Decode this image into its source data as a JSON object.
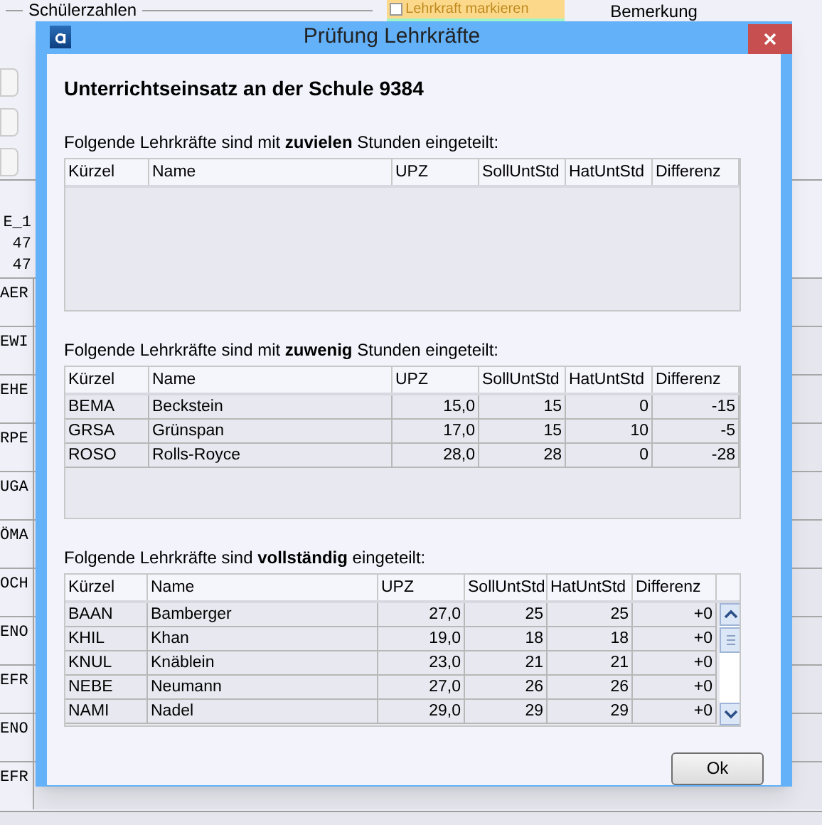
{
  "background": {
    "group_title": "Schülerzahlen",
    "highlight_button": "Lehrkraft markieren",
    "column_header": "Bemerkung",
    "grid_header": [
      "E_1",
      "47",
      "47"
    ],
    "row_labels": [
      "AER",
      "EWI",
      "EHE",
      "RPE",
      "UGA",
      "ÖMA",
      "OCH",
      "ENO",
      "EFR",
      "ENO",
      "EFR"
    ]
  },
  "dialog": {
    "title": "Prüfung Lehrkräfte",
    "heading": "Unterrichtseinsatz an der Schule 9384",
    "sections": [
      {
        "caption": "Folgende Lehrkräfte sind mit **zuvielen** Stunden eingeteilt:",
        "scrollable": false,
        "columns": [
          "Kürzel",
          "Name",
          "UPZ",
          "SollUntStd",
          "HatUntStd",
          "Differenz"
        ]
      },
      {
        "caption": "Folgende Lehrkräfte sind mit **zuwenig** Stunden eingeteilt:",
        "scrollable": false,
        "columns": [
          "Kürzel",
          "Name",
          "UPZ",
          "SollUntStd",
          "HatUntStd",
          "Differenz"
        ],
        "rows": [
          [
            "BEMA",
            "Beckstein",
            "15,0",
            "15",
            "0",
            "-15"
          ],
          [
            "GRSA",
            "Grünspan",
            "17,0",
            "15",
            "10",
            "-5"
          ],
          [
            "ROSO",
            "Rolls-Royce",
            "28,0",
            "28",
            "0",
            "-28"
          ]
        ]
      },
      {
        "caption": "Folgende Lehrkräfte sind **vollständig** eingeteilt:",
        "scrollable": true,
        "columns": [
          "Kürzel",
          "Name",
          "UPZ",
          "SollUntStd",
          "HatUntStd",
          "Differenz"
        ],
        "rows": [
          [
            "BAAN",
            "Bamberger",
            "27,0",
            "25",
            "25",
            "+0"
          ],
          [
            "KHIL",
            "Khan",
            "19,0",
            "18",
            "18",
            "+0"
          ],
          [
            "KNUL",
            "Knäblein",
            "23,0",
            "21",
            "21",
            "+0"
          ],
          [
            "NEBE",
            "Neumann",
            "27,0",
            "26",
            "26",
            "+0"
          ],
          [
            "NAMI",
            "Nadel",
            "29,0",
            "29",
            "29",
            "+0"
          ]
        ]
      }
    ],
    "ok_button": "Ok"
  }
}
